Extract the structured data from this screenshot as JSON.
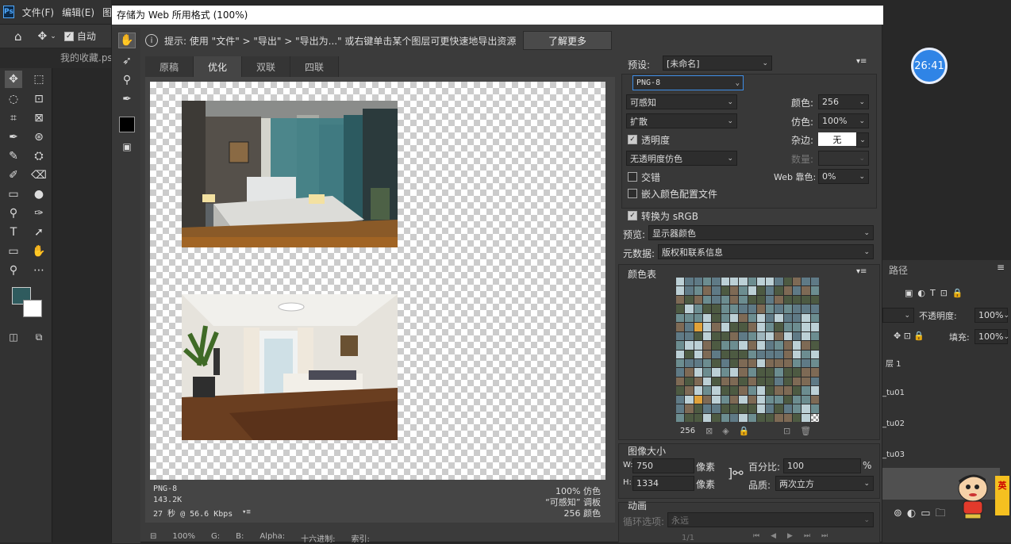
{
  "ps": {
    "logo": "Ps",
    "menu": [
      "文件(F)",
      "编辑(E)",
      "图"
    ],
    "option_auto_label": "自动",
    "doc_tab": "我的收藏.psd",
    "timer": "26:41",
    "paths_tab": "路径",
    "opacity_label": "不透明度:",
    "opacity_value": "100%",
    "fill_label": "填充:",
    "fill_value": "100%",
    "layers": [
      "层 1",
      "_tu01",
      "_tu02",
      "_tu03"
    ],
    "ime_badge": "英"
  },
  "dialog": {
    "title": "存储为 Web 所用格式 (100%)",
    "hint": "提示: 使用 \"文件\" > \"导出\" > \"导出为...\" 或右键单击某个图层可更快速地导出资源",
    "learn_more": "了解更多",
    "tabs": [
      "原稿",
      "优化",
      "双联",
      "四联"
    ],
    "active_tab": "优化",
    "info": {
      "format": "PNG-8",
      "size": "143.2K",
      "time": "27 秒 @ 56.6 Kbps",
      "dither": "100% 仿色",
      "palette": "“可感知” 调板",
      "colors": "256 颜色"
    },
    "zoom": "100%",
    "bottom_labels": [
      "G:",
      "B:",
      "Alpha:",
      "十六进制:",
      "索引:"
    ]
  },
  "settings": {
    "preset_label": "预设:",
    "preset_value": "[未命名]",
    "format": "PNG-8",
    "reduction": "可感知",
    "dither_algo": "扩散",
    "colors_label": "颜色:",
    "colors_value": "256",
    "dither_label": "仿色:",
    "dither_value": "100%",
    "transparency_label": "透明度",
    "matte_label": "杂边:",
    "matte_value": "无",
    "transparency_dither": "无透明度仿色",
    "amount_label": "数量:",
    "interlaced_label": "交错",
    "web_snap_label": "Web 靠色:",
    "web_snap_value": "0%",
    "embed_profile_label": "嵌入颜色配置文件",
    "convert_srgb_label": "转换为 sRGB",
    "preview_label": "预览:",
    "preview_value": "显示器颜色",
    "metadata_label": "元数据:",
    "metadata_value": "版权和联系信息",
    "color_table_label": "颜色表",
    "color_count": "256",
    "image_size_label": "图像大小",
    "w_label": "W:",
    "w_value": "750",
    "h_label": "H:",
    "h_value": "1334",
    "px_label": "像素",
    "percent_label": "百分比:",
    "percent_value": "100",
    "percent_unit": "%",
    "quality_label": "品质:",
    "quality_value": "两次立方",
    "animation_label": "动画",
    "loop_label": "循环选项:",
    "loop_value": "永远",
    "frame": "1/1"
  },
  "colors": {
    "accent": "#2f84e6",
    "focus_border": "#3d8ee8"
  }
}
